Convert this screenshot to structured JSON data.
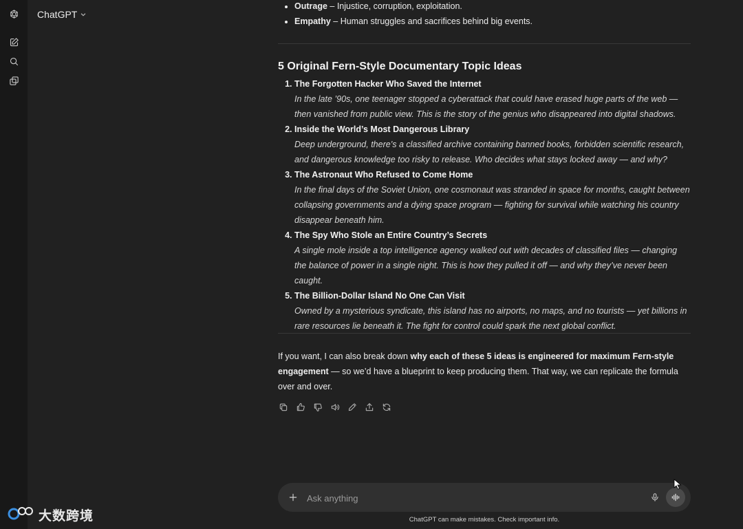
{
  "header": {
    "model_label": "ChatGPT"
  },
  "rail": {
    "icons": [
      "openai-logo-icon",
      "new-chat-icon",
      "search-icon",
      "library-icon"
    ]
  },
  "chat": {
    "bullets": [
      {
        "term": "Outrage",
        "text": " – Injustice, corruption, exploitation."
      },
      {
        "term": "Empathy",
        "text": " – Human struggles and sacrifices behind big events."
      }
    ],
    "section_title": "5 Original Fern-Style Documentary Topic Ideas",
    "ideas": [
      {
        "title": "The Forgotten Hacker Who Saved the Internet",
        "desc": "In the late ’90s, one teenager stopped a cyberattack that could have erased huge parts of the web — then vanished from public view. This is the story of the genius who disappeared into digital shadows."
      },
      {
        "title": "Inside the World’s Most Dangerous Library",
        "desc": "Deep underground, there’s a classified archive containing banned books, forbidden scientific research, and dangerous knowledge too risky to release. Who decides what stays locked away — and why?"
      },
      {
        "title": "The Astronaut Who Refused to Come Home",
        "desc": "In the final days of the Soviet Union, one cosmonaut was stranded in space for months, caught between collapsing governments and a dying space program — fighting for survival while watching his country disappear beneath him."
      },
      {
        "title": "The Spy Who Stole an Entire Country’s Secrets",
        "desc": "A single mole inside a top intelligence agency walked out with decades of classified files — changing the balance of power in a single night. This is how they pulled it off — and why they’ve never been caught."
      },
      {
        "title": "The Billion-Dollar Island No One Can Visit",
        "desc": "Owned by a mysterious syndicate, this island has no airports, no maps, and no tourists — yet billions in rare resources lie beneath it. The fight for control could spark the next global conflict."
      }
    ],
    "followup": {
      "prefix": "If you want, I can also break down ",
      "bold": "why each of these 5 ideas is engineered for maximum Fern-style engagement",
      "suffix": " — so we’d have a blueprint to keep producing them. That way, we can replicate the formula over and over."
    }
  },
  "composer": {
    "placeholder": "Ask anything"
  },
  "footer": {
    "disclaimer": "ChatGPT can make mistakes. Check important info."
  },
  "watermark": {
    "text": "大数跨境"
  }
}
